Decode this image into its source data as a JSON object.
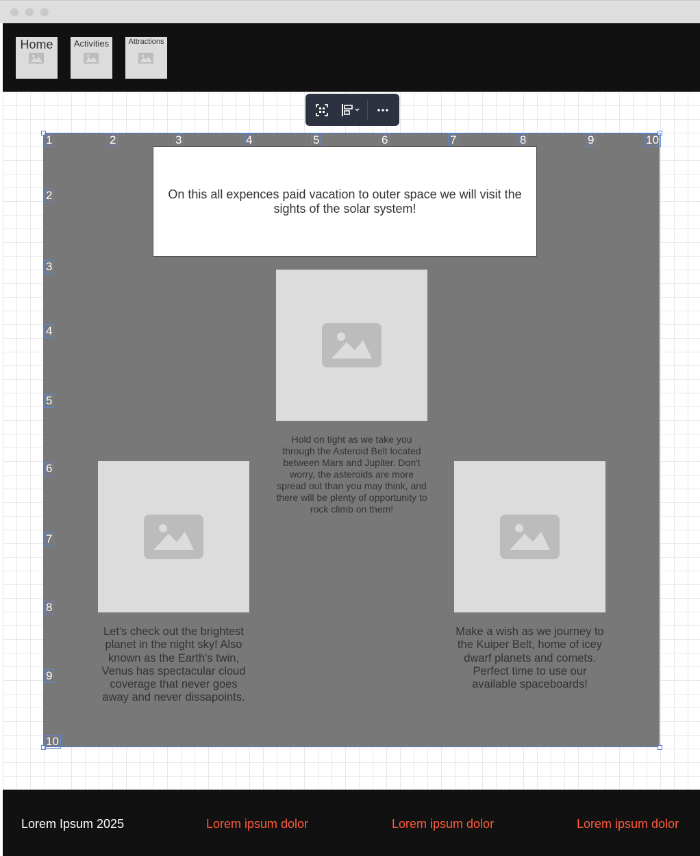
{
  "header": {
    "nav": [
      {
        "label": "Home",
        "icon": "image-placeholder-icon"
      },
      {
        "label": "Activities",
        "icon": "image-placeholder-icon"
      },
      {
        "label": "Attractions",
        "icon": "image-placeholder-icon"
      }
    ]
  },
  "toolbar": {
    "icons": [
      "select-frame-icon",
      "align-icon",
      "more-options-icon"
    ]
  },
  "grid": {
    "columns": [
      "1",
      "2",
      "3",
      "4",
      "5",
      "6",
      "7",
      "8",
      "9",
      "10"
    ],
    "rows": [
      "2",
      "3",
      "4",
      "5",
      "6",
      "7",
      "8",
      "9",
      "10"
    ]
  },
  "content": {
    "intro": "On this all expences paid vacation to outer space we will visit the sights of the solar system!",
    "cards": [
      {
        "caption": "Hold on tight as we take you through the Asteroid Belt located between Mars and Jupiter. Don't worry, the asteroids are more spread out than you may think, and there will be plenty of opportunity to rock climb on them!"
      },
      {
        "caption": "Let's check out the brightest planet in the night sky! Also known as the Earth's twin, Venus has spectacular cloud coverage that never goes away and never dissapoints."
      },
      {
        "caption": "Make a wish as we journey to the Kuiper Belt, home of icey dwarf planets and comets. Perfect time to use our available spaceboards!"
      }
    ]
  },
  "footer": {
    "copyright": "Lorem Ipsum 2025",
    "links": [
      "Lorem ipsum dolor",
      "Lorem ipsum dolor",
      "Lorem ipsum dolor"
    ],
    "link_color": "#ff5a3c"
  }
}
